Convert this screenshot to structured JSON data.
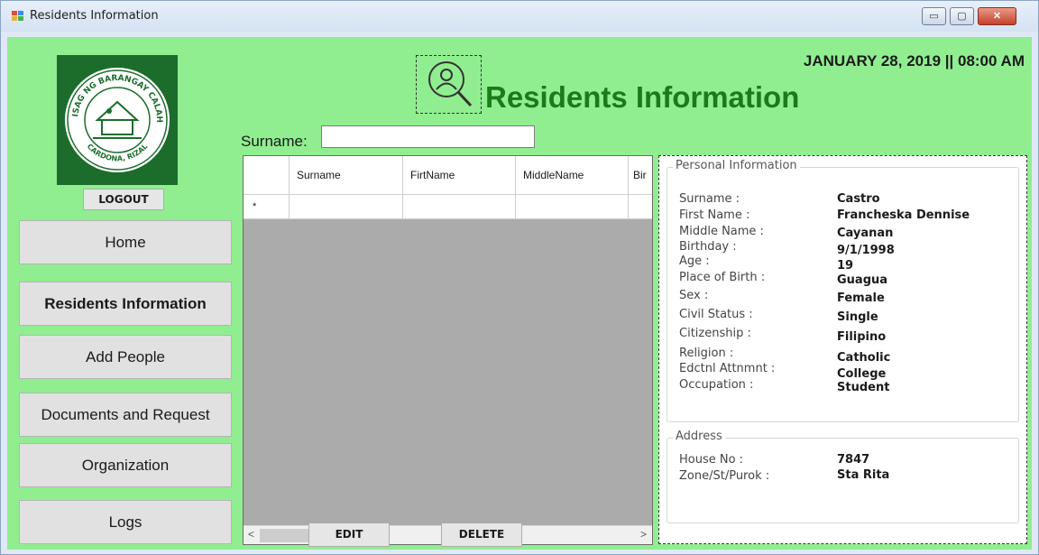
{
  "window": {
    "title": "Residents Information",
    "controls": {
      "minimize": "▭",
      "maximize": "▢",
      "close": "✕"
    }
  },
  "header": {
    "title": "Residents Information",
    "datetime": "JANUARY 28, 2019  ||  08:00 AM",
    "title_color": "#1c7a1c"
  },
  "logo": {
    "seal_text_top": "SAGISAG NG BARANGAY CALAHAN",
    "seal_text_bottom": "CARDONA, RIZAL"
  },
  "sidebar": {
    "logout_label": "LOGOUT",
    "items": [
      {
        "label": "Home"
      },
      {
        "label": "Residents Information"
      },
      {
        "label": "Add People"
      },
      {
        "label": "Documents and Request"
      },
      {
        "label": "Organization"
      },
      {
        "label": "Logs"
      }
    ]
  },
  "search": {
    "label": "Surname:",
    "value": ""
  },
  "grid": {
    "columns": [
      "Surname",
      "FirtName",
      "MiddleName",
      "Bir"
    ],
    "new_row_marker": "*"
  },
  "actions": {
    "edit_label": "EDIT",
    "delete_label": "DELETE"
  },
  "personal_info": {
    "legend": "Personal Information",
    "rows": [
      {
        "label": "Surname :",
        "value": "Castro"
      },
      {
        "label": "First Name :",
        "value": "Francheska Dennise"
      },
      {
        "label": "Middle Name :",
        "value": "Cayanan"
      },
      {
        "label": "Birthday :",
        "value": "9/1/1998"
      },
      {
        "label": "Age :",
        "value": "19"
      },
      {
        "label": "Place of Birth :",
        "value": "Guagua"
      },
      {
        "label": "Sex :",
        "value": "Female"
      },
      {
        "label": "Civil Status :",
        "value": "Single"
      },
      {
        "label": "Citizenship :",
        "value": "Filipino"
      },
      {
        "label": "Religion :",
        "value": "Catholic"
      },
      {
        "label": "Edctnl Attnmnt :",
        "value": "College"
      },
      {
        "label": "Occupation :",
        "value": "Student"
      }
    ]
  },
  "address": {
    "legend": "Address",
    "rows": [
      {
        "label": "House No :",
        "value": "7847"
      },
      {
        "label": "Zone/St/Purok :",
        "value": "Sta Rita"
      }
    ]
  },
  "colors": {
    "background": "#90ee90",
    "logo_bg": "#1c6d2c"
  },
  "icons": {
    "app": "app-window-icon",
    "search": "search-person-icon"
  }
}
